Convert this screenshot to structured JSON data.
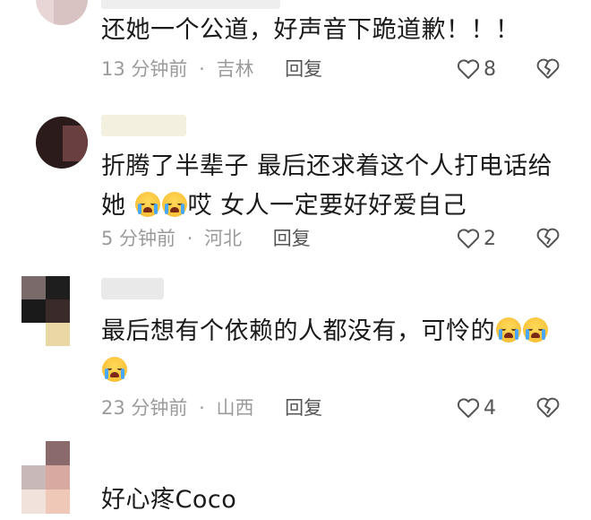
{
  "comments": [
    {
      "text": "还她一个公道，好声音下跪道歉！！！",
      "time": "13 分钟前",
      "location": "吉林",
      "reply": "回复",
      "likes": "8"
    },
    {
      "text_part1": "折腾了半辈子  最后还求着这个人打电话给",
      "text_part2_a": "她 ",
      "text_part2_b": "哎  女人一定要好好爱自己",
      "time": "5 分钟前",
      "location": "河北",
      "reply": "回复",
      "likes": "2"
    },
    {
      "text_part1": "最后想有个依赖的人都没有，可怜的",
      "time": "23 分钟前",
      "location": "山西",
      "reply": "回复",
      "likes": "4"
    },
    {
      "text": "好心疼Coco"
    }
  ],
  "separator": "·",
  "colors": {
    "meta": "#9b9b9b",
    "text": "#1a1a1a",
    "reply": "#555555"
  },
  "icons": {
    "like": "heart-outline-icon",
    "dislike": "broken-heart-icon",
    "emoji": "crying-face-emoji"
  }
}
